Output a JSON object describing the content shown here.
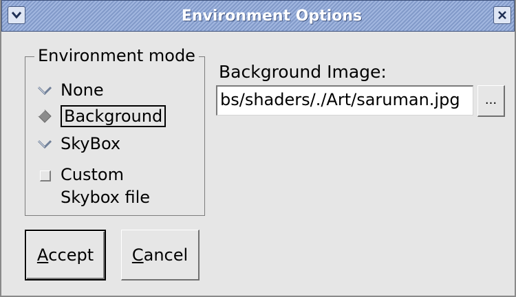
{
  "window": {
    "title": "Environment Options",
    "menu_icon": "chevron-down-icon",
    "close_icon": "close-icon"
  },
  "environment_mode": {
    "title": "Environment mode",
    "options": [
      {
        "label": "None",
        "selected": false
      },
      {
        "label": "Background",
        "selected": true
      },
      {
        "label": "SkyBox",
        "selected": false
      }
    ],
    "custom_skybox": {
      "line1": "Custom",
      "line2": "Skybox file",
      "checked": false
    }
  },
  "background_image": {
    "label": "Background Image:",
    "value": "bs/shaders/./Art/saruman.jpg",
    "browse_label": "..."
  },
  "buttons": {
    "accept_mnemonic": "A",
    "accept_rest": "ccept",
    "cancel_mnemonic": "C",
    "cancel_rest": "ancel"
  },
  "colors": {
    "titlebar": "#8ca6d8",
    "background": "#e6e6e6",
    "radio_selected": "#8c8c8c",
    "radio_unselected": "#7c8aa0"
  }
}
